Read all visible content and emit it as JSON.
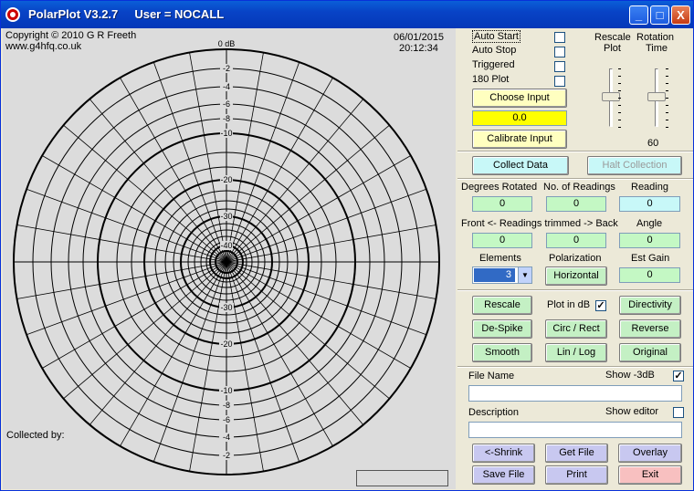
{
  "window": {
    "title": "PolarPlot V3.2.7     User = NOCALL",
    "buttons": {
      "minimize": "_",
      "maximize": "□",
      "close": "X"
    }
  },
  "plot": {
    "copyright": "Copyright © 2010 G R Freeth",
    "website": "www.g4hfq.co.uk",
    "date": "06/01/2015",
    "time": "20:12:34",
    "zero_label": "0 dB",
    "collected_by": "Collected by:",
    "scale_labels_top": [
      "-2",
      "-4",
      "-6",
      "-8",
      "-10",
      "-20",
      "-30",
      "-40"
    ],
    "scale_labels_bottom": [
      "-30",
      "-20",
      "-10",
      "-2",
      "-4",
      "-6",
      "-8"
    ]
  },
  "controls": {
    "auto_start": "Auto Start",
    "auto_stop": "Auto Stop",
    "triggered": "Triggered",
    "plot_180": "180 Plot",
    "choose_input": "Choose Input",
    "input_value": "0.0",
    "calibrate_input": "Calibrate Input",
    "rescale_plot": "Rescale",
    "rescale_plot_2": "Plot",
    "rotation_time": "Rotation",
    "rotation_time_2": "Time",
    "rotation_value": "60",
    "collect_data": "Collect Data",
    "halt_collection": "Halt Collection",
    "degrees_rotated_label": "Degrees Rotated",
    "degrees_rotated": "0",
    "num_readings_label": "No. of Readings",
    "num_readings": "0",
    "reading_label": "Reading",
    "reading": "0",
    "front_back_label": "Front <- Readings trimmed -> Back",
    "front": "0",
    "back": "0",
    "angle_label": "Angle",
    "angle": "0",
    "elements_label": "Elements",
    "elements": "3",
    "polarization_label": "Polarization",
    "polarization": "Horizontal",
    "est_gain_label": "Est Gain",
    "est_gain": "0",
    "rescale": "Rescale",
    "plot_in_db": "Plot in dB",
    "directivity": "Directivity",
    "despike": "De-Spike",
    "circ_rect": "Circ / Rect",
    "reverse": "Reverse",
    "smooth": "Smooth",
    "lin_log": "Lin / Log",
    "original": "Original",
    "file_name_label": "File Name",
    "show_3db": "Show -3dB",
    "description_label": "Description",
    "show_editor": "Show editor",
    "shrink": "<-Shrink",
    "get_file": "Get File",
    "overlay": "Overlay",
    "save_file": "Save File",
    "print": "Print",
    "exit": "Exit",
    "checked_mark": "✓"
  }
}
